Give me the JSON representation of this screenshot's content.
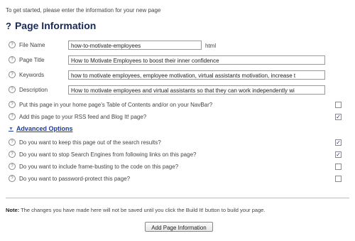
{
  "intro": "To get started, please enter the information for your new page",
  "title": "Page Information",
  "title_icon": "?",
  "fields": {
    "file_name": {
      "label": "File Name",
      "value": "how-to-motivate-employees",
      "suffix": "html"
    },
    "page_title": {
      "label": "Page Title",
      "value": "How to Motivate Employees to boost their inner confidence"
    },
    "keywords": {
      "label": "Keywords",
      "value": "how to motivate employees, employee motivation, virtual assistants motivation, increase t"
    },
    "description": {
      "label": "Description",
      "value": "How to motivate employees and virtual assistants so that they can work independently wi"
    }
  },
  "options": [
    {
      "label": "Put this page in your home page's Table of Contents and/or on your NavBar?",
      "checked": false
    },
    {
      "label": "Add this page to your RSS feed and Blog It! page?",
      "checked": true
    }
  ],
  "advanced": {
    "label": "Advanced Options",
    "options": [
      {
        "label": "Do you want to keep this page out of the search results?",
        "checked": true
      },
      {
        "label": "Do you want to stop Search Engines from following links on this page?",
        "checked": true
      },
      {
        "label": "Do you want to include frame-busting to the code on this page?",
        "checked": false
      },
      {
        "label": "Do you want to password-protect this page?",
        "checked": false
      }
    ]
  },
  "note": {
    "bold": "Note:",
    "text": " The changes you have made here will not be saved until you click the Build It! button to build your page."
  },
  "submit_label": "Add Page Information",
  "check_mark": "✓",
  "help_glyph": "?"
}
